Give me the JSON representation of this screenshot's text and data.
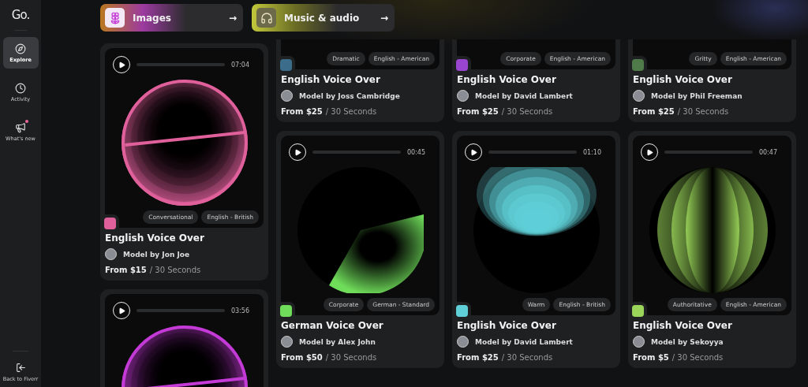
{
  "sidebar": {
    "logo": "Go.",
    "items": [
      {
        "label": "Explore",
        "kind": "compass",
        "selected": true,
        "badge": false
      },
      {
        "label": "Activity",
        "kind": "clock",
        "selected": false,
        "badge": false
      },
      {
        "label": "What's new",
        "kind": "megaphone",
        "selected": false,
        "badge": true
      }
    ],
    "footer": {
      "label": "Back to Fiverr"
    }
  },
  "categories": [
    {
      "label": "Images",
      "arrow": "→",
      "kind": "images"
    },
    {
      "label": "Music & audio",
      "arrow": "→",
      "kind": "music"
    }
  ],
  "columns": [
    {
      "cards": [
        {
          "kind": "rings",
          "duration": "07:04",
          "color": "#e0609c",
          "tags": [
            "Conversational",
            "English - British"
          ],
          "title": "English Voice Over",
          "model": "Model by Jon Joe",
          "price": "From $15",
          "unit": "/ 30 Seconds"
        },
        {
          "kind": "rings",
          "duration": "03:56",
          "color": "#c43ad6"
        }
      ]
    },
    {
      "cards": [
        {
          "kind": "clipped",
          "tags": [
            "Dramatic",
            "English - American"
          ],
          "title": "English Voice Over",
          "model": "Model by Joss Cambridge",
          "price": "From $25",
          "unit": "/ 30 Seconds",
          "color": "#3b6d8a"
        },
        {
          "kind": "sweep",
          "duration": "00:45",
          "color": "#6fdc5a",
          "tags": [
            "Corporate",
            "German - Standard"
          ],
          "title": "German Voice Over",
          "model": "Model by Alex John",
          "price": "From $50",
          "unit": "/ 30 Seconds"
        }
      ]
    },
    {
      "cards": [
        {
          "kind": "clipped",
          "tags": [
            "Corporate",
            "English - American"
          ],
          "title": "English Voice Over",
          "model": "Model by David Lambert",
          "price": "From $25",
          "unit": "/ 30 Seconds",
          "color": "#9a45d0"
        },
        {
          "kind": "cone",
          "duration": "01:10",
          "color": "#5fd0d8",
          "tags": [
            "Warm",
            "English - British"
          ],
          "title": "English Voice Over",
          "model": "Model by David Lambert",
          "price": "From $25",
          "unit": "/ 30 Seconds"
        }
      ]
    },
    {
      "cards": [
        {
          "kind": "clipped",
          "tags": [
            "Gritty",
            "English - American"
          ],
          "title": "English Voice Over",
          "model": "Model by Phil Freeman",
          "price": "From $25",
          "unit": "/ 30 Seconds",
          "color": "#4f7a4a"
        },
        {
          "kind": "bands",
          "duration": "00:47",
          "color": "#9bd65a",
          "tags": [
            "Authoritative",
            "English - American"
          ],
          "title": "English Voice Over",
          "model": "Model by Sekoyya",
          "price": "From $5",
          "unit": "/ 30 Seconds"
        }
      ]
    }
  ]
}
